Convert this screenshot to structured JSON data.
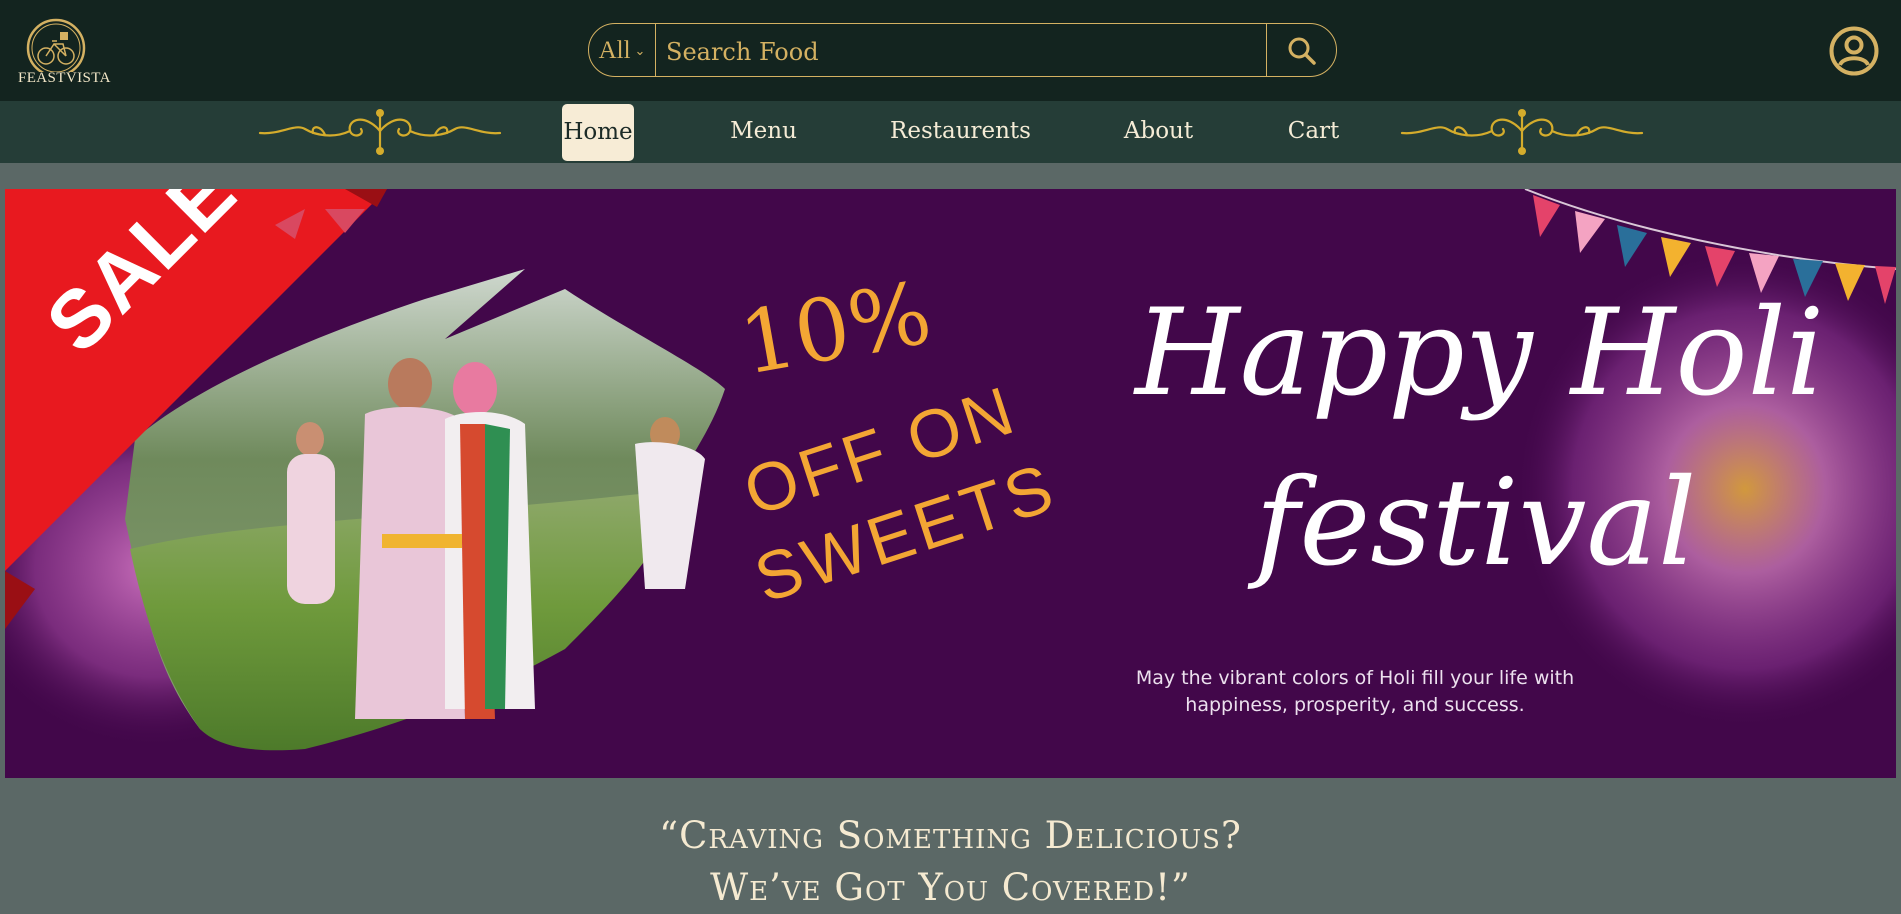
{
  "brand": {
    "name": "FEASTVISTA"
  },
  "search": {
    "category": "All",
    "placeholder": "Search Food"
  },
  "nav": {
    "items": [
      {
        "label": "Home",
        "active": true
      },
      {
        "label": "Menu"
      },
      {
        "label": "Restaurents"
      },
      {
        "label": "About"
      },
      {
        "label": "Cart"
      }
    ]
  },
  "banner": {
    "sale_label": "SALE",
    "offer_percent": "10%",
    "offer_line1": "OFF ON",
    "offer_line2": "SWEETS",
    "title_line1": "Happy Holi",
    "title_line2": "festival",
    "message_line1": "May the vibrant colors of Holi fill your life with",
    "message_line2": "happiness, prosperity, and success."
  },
  "tagline": {
    "line1": "“Craving Something Delicious?",
    "line2": "We’ve Got You Covered!”"
  },
  "colors": {
    "topbar": "#13241f",
    "navbar": "#253d37",
    "page_bg": "#5b6866",
    "accent_gold": "#d4b162",
    "banner_bg": "#42074a",
    "offer_orange": "#f3a634",
    "sale_red": "#e8191f"
  },
  "icons": [
    "bicycle-logo-icon",
    "chevron-down-icon",
    "search-icon",
    "user-circle-icon",
    "ornament-icon"
  ]
}
